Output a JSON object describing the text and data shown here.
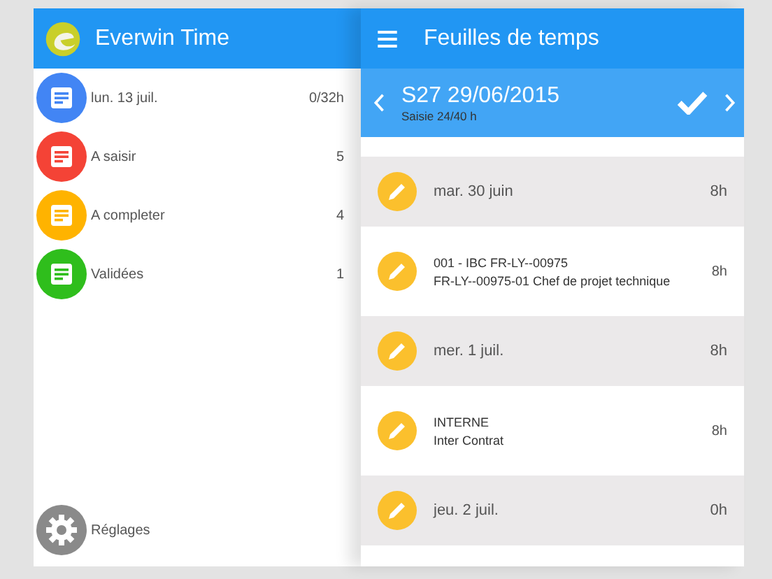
{
  "drawer": {
    "title": "Everwin Time",
    "items": [
      {
        "label": "lun. 13 juil.",
        "count": "0/32h",
        "color": "#4285f4"
      },
      {
        "label": "A saisir",
        "count": "5",
        "color": "#f44336"
      },
      {
        "label": "A completer",
        "count": "4",
        "color": "#ffb300"
      },
      {
        "label": "Validées",
        "count": "1",
        "color": "#2fbe1c"
      }
    ],
    "settings": {
      "label": "Réglages"
    }
  },
  "main": {
    "title": "Feuilles de temps",
    "week": {
      "title": "S27 29/06/2015",
      "subtitle": "Saisie 24/40 h"
    },
    "rows": [
      {
        "kind": "day",
        "label": "mar. 30 juin",
        "hours": "8h"
      },
      {
        "kind": "entry",
        "line1": "001 - IBC FR-LY--00975",
        "line2": "FR-LY--00975-01 Chef de projet technique",
        "hours": "8h"
      },
      {
        "kind": "day",
        "label": "mer. 1 juil.",
        "hours": "8h"
      },
      {
        "kind": "entry",
        "line1": "INTERNE",
        "line2": "Inter Contrat",
        "hours": "8h"
      },
      {
        "kind": "day",
        "label": "jeu. 2 juil.",
        "hours": "0h"
      }
    ]
  }
}
